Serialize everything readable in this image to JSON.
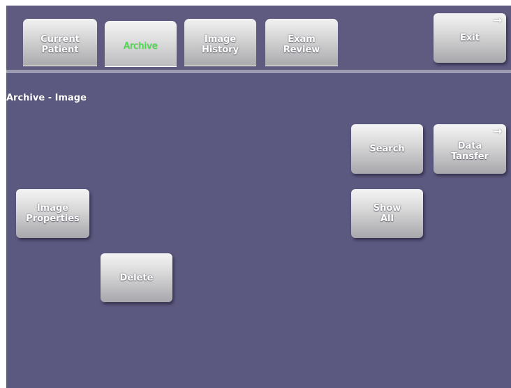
{
  "tabs": [
    {
      "label": "Current\nPatient",
      "active": false
    },
    {
      "label": "Archive",
      "active": true
    },
    {
      "label": "Image\nHistory",
      "active": false
    },
    {
      "label": "Exam\nReview",
      "active": false
    }
  ],
  "header": {
    "exit_label": "Exit",
    "exit_arrow": "→"
  },
  "main": {
    "title": "Archive - Image",
    "buttons": {
      "search": "Search",
      "data_transfer": "Data\nTansfer",
      "data_transfer_arrow": "→",
      "show_all": "Show\nAll",
      "image_properties": "Image\nProperties",
      "delete": "Delete"
    }
  },
  "colors": {
    "background": "#5e5a80",
    "active_tab_text": "#45e045",
    "button_text": "#ffffff"
  }
}
